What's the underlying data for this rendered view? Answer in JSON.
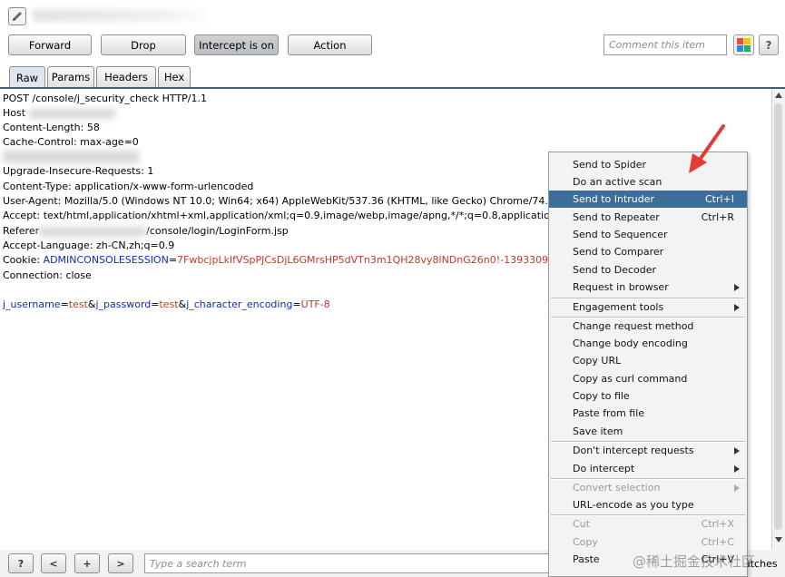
{
  "toolbar": {
    "forward_label": "Forward",
    "drop_label": "Drop",
    "intercept_label": "Intercept is on",
    "action_label": "Action",
    "comment_placeholder": "Comment this item",
    "help_label": "?"
  },
  "tabs": [
    {
      "label": "Raw",
      "active": true
    },
    {
      "label": "Params",
      "active": false
    },
    {
      "label": "Headers",
      "active": false
    },
    {
      "label": "Hex",
      "active": false
    }
  ],
  "request": {
    "line1": "POST /console/j_security_check HTTP/1.1",
    "host_key": "Host",
    "content_length": "Content-Length: 58",
    "cache_control": "Cache-Control: max-age=0",
    "upgrade": "Upgrade-Insecure-Requests: 1",
    "content_type": "Content-Type: application/x-www-form-urlencoded",
    "user_agent": "User-Agent: Mozilla/5.0 (Windows NT 10.0; Win64; x64) AppleWebKit/537.36 (KHTML, like Gecko) Chrome/74.0.3729.157 S",
    "accept": "Accept: text/html,application/xhtml+xml,application/xml;q=0.9,image/webp,image/apng,*/*;q=0.8,application/signed-exchange",
    "referer_key": "Referer",
    "referer_path": "/console/login/LoginForm.jsp",
    "accept_language": "Accept-Language: zh-CN,zh;q=0.9",
    "cookie_key": "Cookie: ",
    "cookie_name": "ADMINCONSOLESESSION",
    "cookie_eq": "=",
    "cookie_value": "7FwbcjpLkIfVSpPJCsDjL6GMrsHP5dVTn3m1QH28vy8lNDnG26n0!-139330991",
    "connection": "Connection: close",
    "body": {
      "p1_name": "j_username",
      "p1_value": "test",
      "p2_name": "j_password",
      "p2_value": "test",
      "p3_name": "j_character_encoding",
      "p3_value": "UTF-8",
      "eq": "=",
      "amp": "&"
    }
  },
  "context_menu": [
    {
      "label": "Send to Spider"
    },
    {
      "label": "Do an active scan"
    },
    {
      "label": "Send to Intruder",
      "shortcut": "Ctrl+I",
      "highlighted": true
    },
    {
      "label": "Send to Repeater",
      "shortcut": "Ctrl+R"
    },
    {
      "label": "Send to Sequencer"
    },
    {
      "label": "Send to Comparer"
    },
    {
      "label": "Send to Decoder"
    },
    {
      "label": "Request in browser",
      "submenu": true
    },
    {
      "label": "Engagement tools",
      "submenu": true
    },
    {
      "label": "Change request method"
    },
    {
      "label": "Change body encoding"
    },
    {
      "label": "Copy URL"
    },
    {
      "label": "Copy as curl command"
    },
    {
      "label": "Copy to file"
    },
    {
      "label": "Paste from file"
    },
    {
      "label": "Save item"
    },
    {
      "label": "Don't intercept requests",
      "submenu": true
    },
    {
      "label": "Do intercept",
      "submenu": true
    },
    {
      "label": "Convert selection",
      "submenu": true,
      "disabled": true
    },
    {
      "label": "URL-encode as you type"
    },
    {
      "label": "Cut",
      "shortcut": "Ctrl+X",
      "disabled": true
    },
    {
      "label": "Copy",
      "shortcut": "Ctrl+C",
      "disabled": true
    },
    {
      "label": "Paste",
      "shortcut": "Ctrl+V"
    }
  ],
  "search": {
    "placeholder": "Type a search term",
    "help_label": "?",
    "prev_label": "<",
    "add_label": "+",
    "next_label": ">",
    "matches_label": "atches"
  },
  "watermark": "@稀土掘金技术社区",
  "colors": {
    "menu_highlight": "#3d6d99",
    "param_name": "#0f2bbd",
    "param_value": "#c0392b",
    "tab_underline": "#4a5a70"
  }
}
